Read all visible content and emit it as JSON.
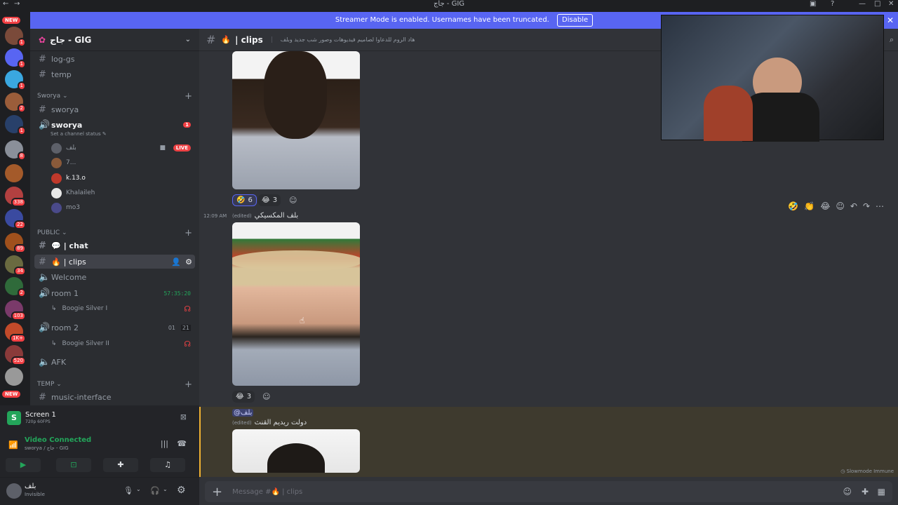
{
  "window": {
    "title": "جاج - GIG"
  },
  "banner": {
    "text": "Streamer Mode is enabled. Usernames have been truncated.",
    "disable_label": "Disable"
  },
  "servers": [
    {
      "badge": "1",
      "color": "#7a4a3a"
    },
    {
      "badge": "1",
      "color": "#5865f2"
    },
    {
      "badge": "1",
      "color": "#3aa7e0"
    },
    {
      "badge": "2",
      "color": "#9b5d3a"
    },
    {
      "badge": "1",
      "color": "#28406a"
    },
    {
      "badge": "8",
      "color": "#8a8f99"
    },
    {
      "badge": "",
      "color": "#a45a2a"
    },
    {
      "badge": "338",
      "color": "#b24040"
    },
    {
      "badge": "22",
      "color": "#3a4aa0"
    },
    {
      "badge": "89",
      "color": "#a0501c"
    },
    {
      "badge": "34",
      "color": "#6a6a40"
    },
    {
      "badge": "2",
      "color": "#2f6a3a"
    },
    {
      "badge": "103",
      "color": "#7a3a6a"
    },
    {
      "badge": "1K+",
      "color": "#c24a2a"
    },
    {
      "badge": "520",
      "color": "#8a3a3a"
    },
    {
      "badge": "",
      "color": "#999999"
    }
  ],
  "new_tag": "NEW",
  "guild": {
    "name": "جاج - GIG"
  },
  "channels_top": [
    {
      "label": "log-gs"
    },
    {
      "label": "temp"
    }
  ],
  "category_sworya": "Sworya",
  "sworya_text": "sworya",
  "sworya_voice": {
    "label": "sworya",
    "status": "Set a channel status",
    "badge": "1"
  },
  "voice_users": [
    {
      "name": "بلف",
      "live": "LIVE"
    },
    {
      "name": "7..."
    },
    {
      "name": "k.13.o"
    },
    {
      "name": "Khalaileh"
    },
    {
      "name": "mo3"
    }
  ],
  "category_public": "PUBLIC",
  "public_channels": {
    "chat": "| chat",
    "clips": "| clips",
    "welcome": "Welcome",
    "room1": "room 1",
    "room1_time": "57:35:20",
    "room1_user": "Boogie Silver I",
    "room2": "room 2",
    "room2_count_a": "01",
    "room2_count_b": "21",
    "room2_user": "Boogie Silver II",
    "afk": "AFK"
  },
  "category_temp": "TEMP",
  "temp_channel": "music-interface",
  "screen_share": {
    "title": "Screen 1",
    "quality": "720p 60FPS"
  },
  "voice_status": {
    "title": "Video Connected",
    "subtitle": "sworya / جاج - GIG"
  },
  "user": {
    "name": "بلف",
    "status": "Invisible"
  },
  "header": {
    "channel": "| clips",
    "topic": "هاد الروم للدعاوا لصاميم فيديوهات وصور شب جديد وبلف"
  },
  "reactions_1": [
    {
      "emoji": "🤣",
      "count": "6"
    },
    {
      "emoji": "😂",
      "count": "3"
    }
  ],
  "message_2": {
    "time": "12:09 AM",
    "edited": "(edited)",
    "text": "بلف المكسيكي"
  },
  "reactions_2": [
    {
      "emoji": "😂",
      "count": "3"
    }
  ],
  "message_3": {
    "mention": "@بلف",
    "edited": "(edited)",
    "text": "دولت ريديم القنث"
  },
  "slowmode": "Slowmode Immune",
  "composer": {
    "placeholder": "Message #🔥 | clips"
  }
}
